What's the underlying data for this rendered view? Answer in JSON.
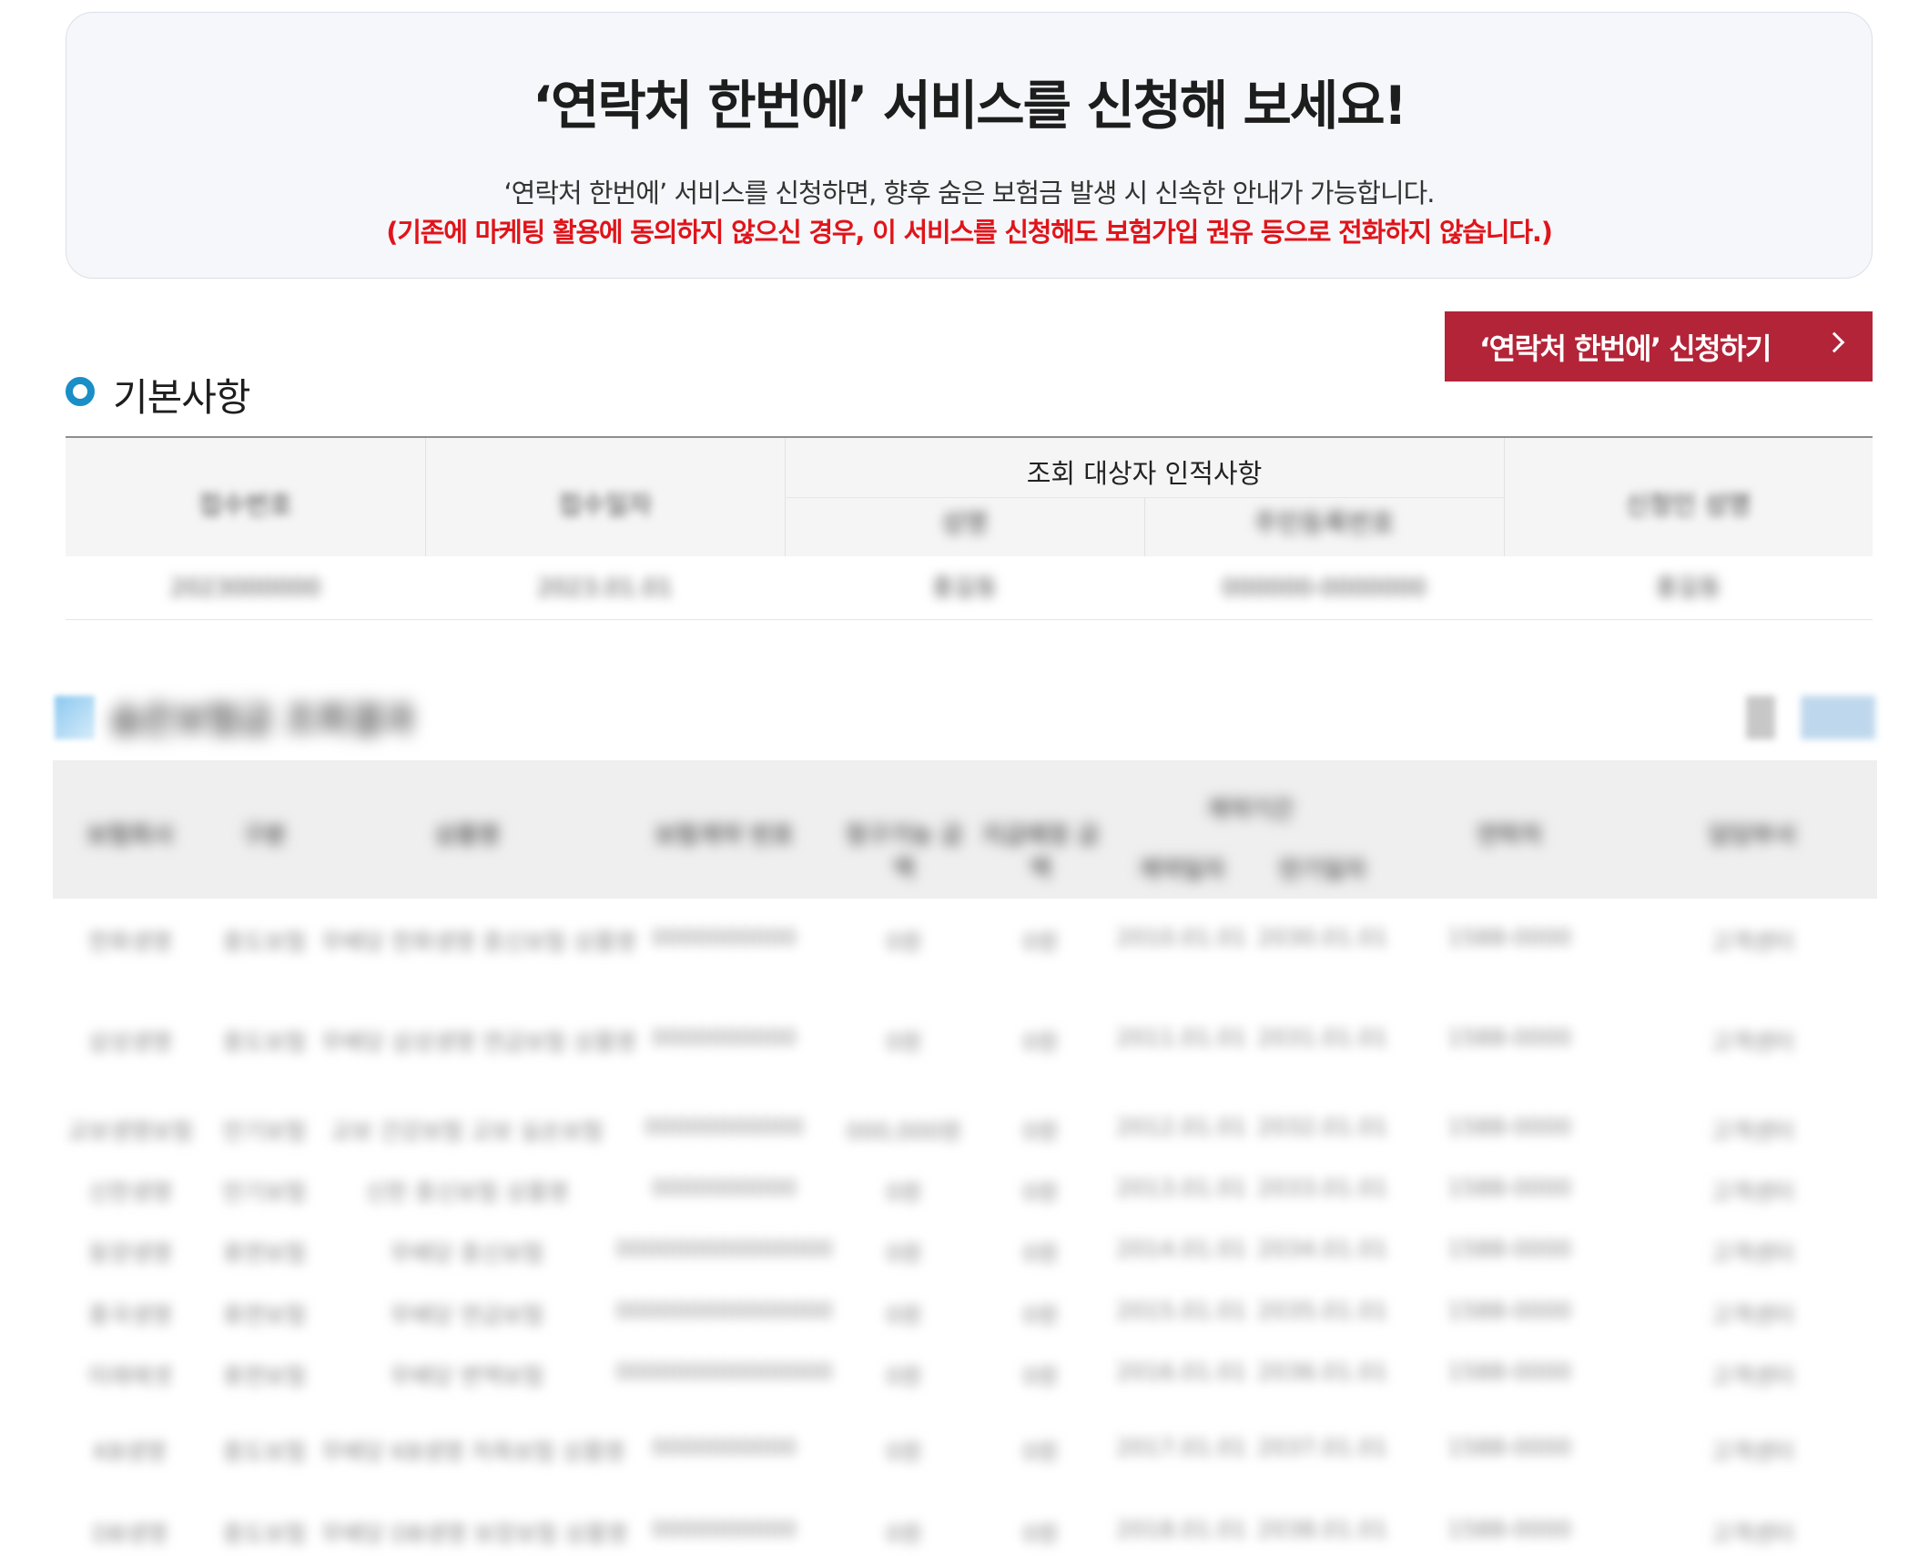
{
  "banner": {
    "title": "‘연락처 한번에’ 서비스를 신청해 보세요!",
    "description": "‘연락처 한번에’ 서비스를 신청하면, 향후 숨은 보험금 발생 시 신속한 안내가 가능합니다.",
    "warning": "(기존에 마케팅 활용에 동의하지 않으신 경우, 이 서비스를 신청해도 보험가입 권유 등으로 전화하지 않습니다.)"
  },
  "apply_button": {
    "label": "‘연락처 한번에’ 신청하기"
  },
  "basic_section": {
    "title": "기본사항",
    "table": {
      "headers": [
        "접수번호",
        "접수일자",
        "조회 대상자 인적사항",
        "신청인 성명"
      ],
      "subheaders": [
        "성명",
        "주민등록번호"
      ],
      "row": [
        "2023000000",
        "2023.01.01",
        "홍길동",
        "000000-0000000",
        "홍길동"
      ]
    }
  },
  "detail_section": {
    "title": "숨은보험금 조회결과",
    "headers": [
      "보험회사",
      "구분",
      "상품명",
      "보험계약 번호",
      "청구가능 금액",
      "지급예정 금액",
      "계약일자",
      "만기일자",
      "연락처",
      "담당부서"
    ],
    "group_header": "계약기간",
    "rows": [
      [
        "한화생명",
        "중도보험",
        "무배당 한화생명 종신보험 상품명",
        "0000000000",
        "0원",
        "0원",
        "2010.01.01",
        "2030.01.01",
        "1588-0000",
        "고객센터"
      ],
      [
        "삼성생명",
        "중도보험",
        "무배당 삼성생명 연금보험 상품명",
        "0000000000",
        "0원",
        "0원",
        "2011.01.01",
        "2031.01.01",
        "1588-0000",
        "고객센터"
      ],
      [
        "교보생명보험",
        "만기보험",
        "교보 건강보험 교보 실손보험",
        "00000000000",
        "000,000원",
        "0원",
        "2012.01.01",
        "2032.01.01",
        "1588-0000",
        "고객센터"
      ],
      [
        "신한생명",
        "만기보험",
        "신한 종신보험 상품명",
        "0000000000",
        "0원",
        "0원",
        "2013.01.01",
        "2033.01.01",
        "1588-0000",
        "고객센터"
      ],
      [
        "동양생명",
        "휴면보험",
        "무배당 종신보험",
        "000000000000000",
        "0원",
        "0원",
        "2014.01.01",
        "2034.01.01",
        "1588-0000",
        "고객센터"
      ],
      [
        "흥국생명",
        "휴면보험",
        "무배당 연금보험",
        "000000000000000",
        "0원",
        "0원",
        "2015.01.01",
        "2035.01.01",
        "1588-0000",
        "고객센터"
      ],
      [
        "미래에셋",
        "휴면보험",
        "무배당 변액보험",
        "000000000000000",
        "0원",
        "0원",
        "2016.01.01",
        "2036.01.01",
        "1588-0000",
        "고객센터"
      ],
      [
        "KB생명",
        "중도보험",
        "무배당 KB생명 저축보험 상품명",
        "0000000000",
        "0원",
        "0원",
        "2017.01.01",
        "2037.01.01",
        "1588-0000",
        "고객센터"
      ],
      [
        "DB생명",
        "중도보험",
        "무배당 DB생명 보장보험 상품명",
        "0000000000",
        "0원",
        "0원",
        "2018.01.01",
        "2038.01.01",
        "1588-0000",
        "고객센터"
      ]
    ],
    "controls": [
      "인쇄",
      "엑셀"
    ]
  }
}
